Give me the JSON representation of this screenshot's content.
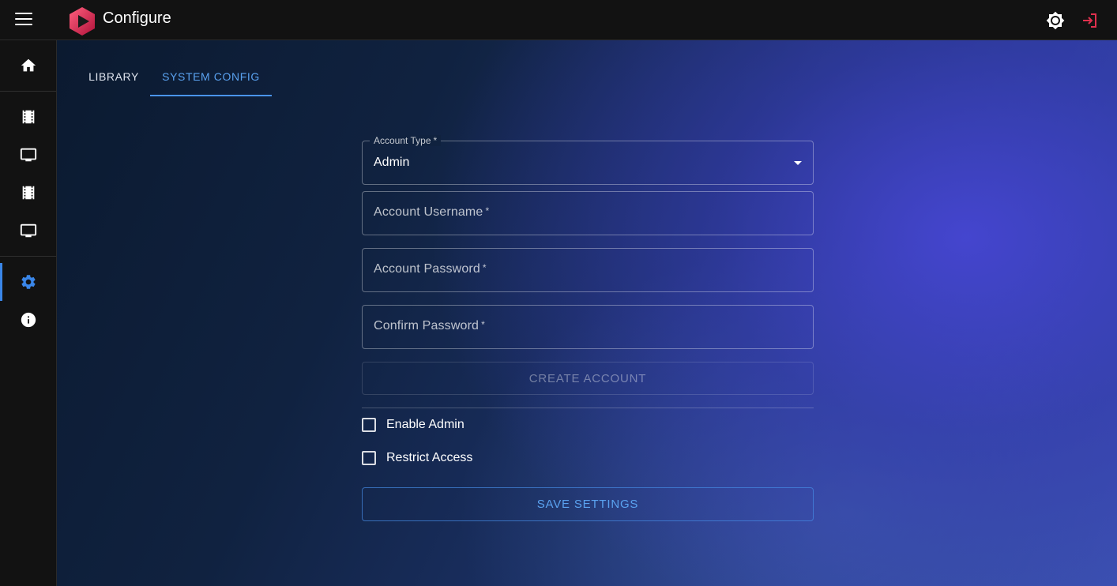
{
  "header": {
    "title": "Configure",
    "menu_icon": "menu-icon",
    "logo_icon": "app-logo-icon",
    "theme_icon": "brightness-icon",
    "logout_icon": "logout-icon",
    "logout_color": "#e0304e"
  },
  "sidebar": {
    "accent": "#3a86e8",
    "items": [
      {
        "icon": "home-icon"
      },
      {
        "icon": "film-icon"
      },
      {
        "icon": "tv-icon"
      },
      {
        "icon": "film-icon"
      },
      {
        "icon": "tv-icon"
      },
      {
        "icon": "settings-icon",
        "active": true
      },
      {
        "icon": "info-icon"
      }
    ]
  },
  "tabs": [
    {
      "label": "LIBRARY"
    },
    {
      "label": "SYSTEM CONFIG",
      "active": true
    }
  ],
  "form": {
    "account_type": {
      "label": "Account Type",
      "required_mark": "*",
      "value": "Admin"
    },
    "username": {
      "label": "Account Username",
      "required_mark": "*",
      "value": ""
    },
    "password": {
      "label": "Account Password",
      "required_mark": "*",
      "value": ""
    },
    "confirm": {
      "label": "Confirm Password",
      "required_mark": "*",
      "value": ""
    },
    "create_button": "CREATE ACCOUNT",
    "enable_admin": {
      "label": "Enable Admin",
      "checked": false
    },
    "restrict_access": {
      "label": "Restrict Access",
      "checked": false
    },
    "save_button": "SAVE SETTINGS"
  }
}
